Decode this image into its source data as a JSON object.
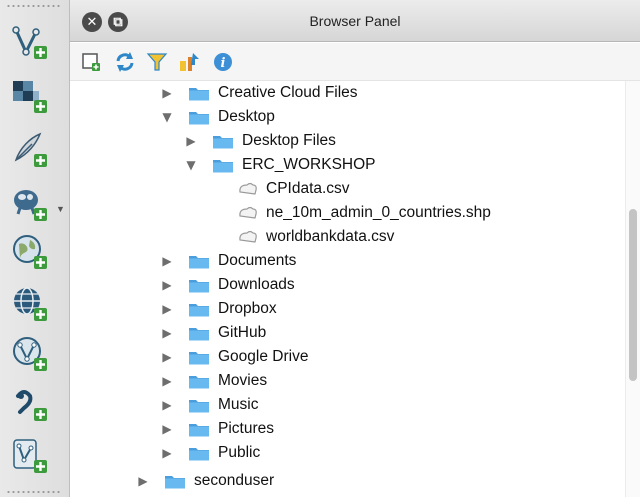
{
  "panel": {
    "title": "Browser Panel"
  },
  "left_toolbar": {
    "tools": [
      "add-vector-layer-icon",
      "add-raster-layer-icon",
      "add-delimited-text-layer-icon",
      "add-postgis-layer-icon",
      "add-wms-layer-icon",
      "add-wfs-layer-icon",
      "add-wcs-layer-icon",
      "add-spatialite-layer-icon",
      "add-virtual-layer-icon"
    ]
  },
  "panel_toolbar": {
    "buttons": [
      "add-selected-layers-icon",
      "refresh-icon",
      "filter-icon",
      "collapse-all-icon",
      "properties-info-icon"
    ]
  },
  "tree": {
    "items": [
      {
        "label": "Creative Cloud Files",
        "type": "folder",
        "expanded": false
      },
      {
        "label": "Desktop",
        "type": "folder",
        "expanded": true
      },
      {
        "label": "Desktop Files",
        "type": "folder",
        "expanded": false
      },
      {
        "label": "ERC_WORKSHOP",
        "type": "folder",
        "expanded": true
      },
      {
        "label": "CPIdata.csv",
        "type": "file"
      },
      {
        "label": "ne_10m_admin_0_countries.shp",
        "type": "file"
      },
      {
        "label": "worldbankdata.csv",
        "type": "file"
      },
      {
        "label": "Documents",
        "type": "folder",
        "expanded": false
      },
      {
        "label": "Downloads",
        "type": "folder",
        "expanded": false
      },
      {
        "label": "Dropbox",
        "type": "folder",
        "expanded": false
      },
      {
        "label": "GitHub",
        "type": "folder",
        "expanded": false
      },
      {
        "label": "Google Drive",
        "type": "folder",
        "expanded": false
      },
      {
        "label": "Movies",
        "type": "folder",
        "expanded": false
      },
      {
        "label": "Music",
        "type": "folder",
        "expanded": false
      },
      {
        "label": "Pictures",
        "type": "folder",
        "expanded": false
      },
      {
        "label": "Public",
        "type": "folder",
        "expanded": false
      },
      {
        "label": "seconduser",
        "type": "folder",
        "expanded": false
      }
    ]
  },
  "colors": {
    "folder": "#5fb3ec",
    "folder_tab": "#4a9ede",
    "titlebar": "#dcdcdc"
  }
}
